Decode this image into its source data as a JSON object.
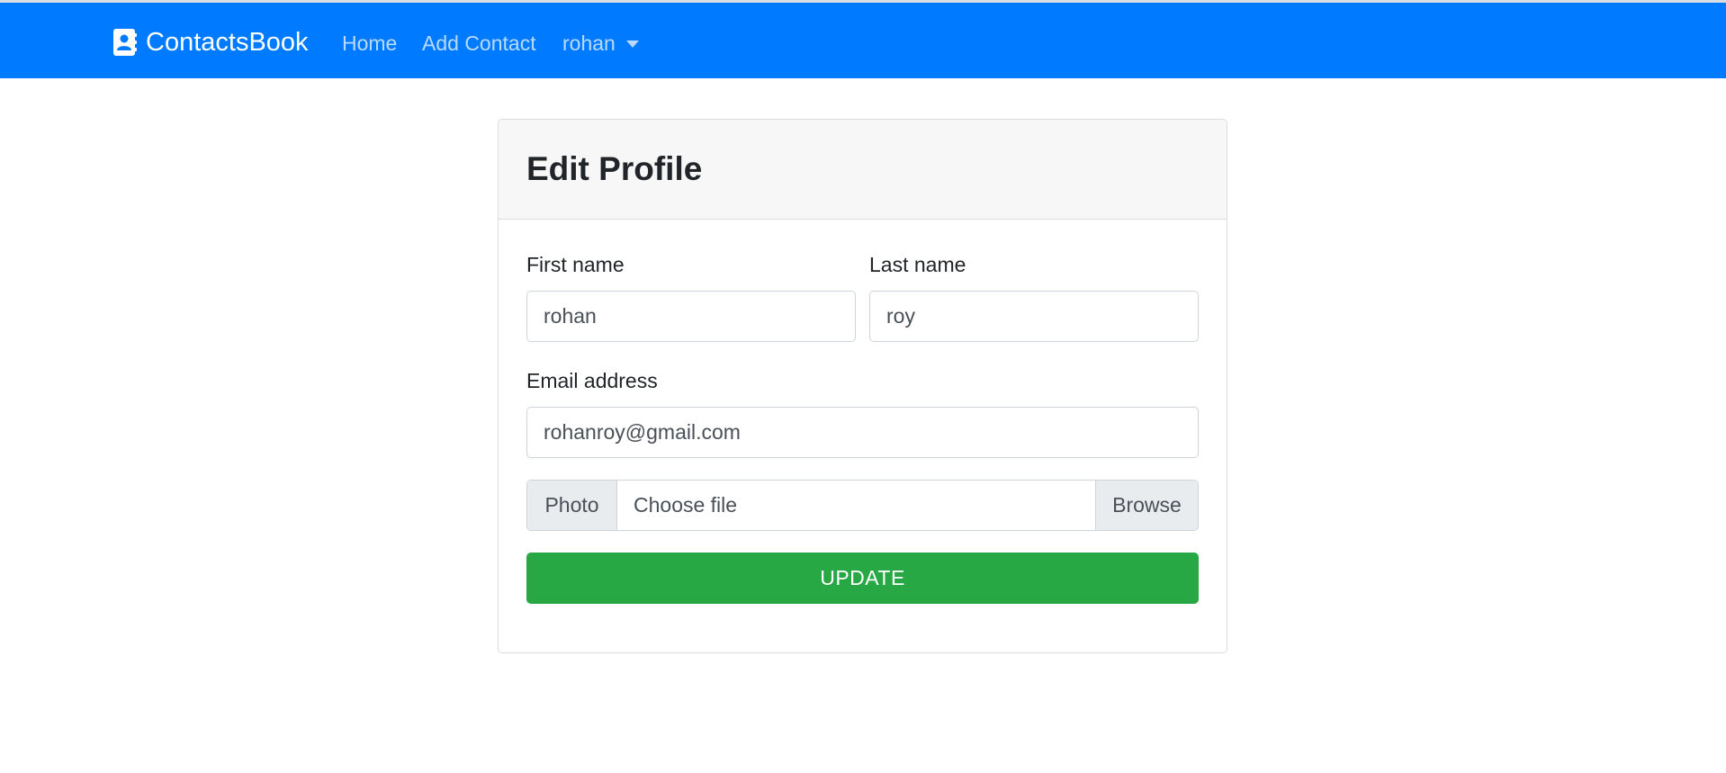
{
  "nav": {
    "brand": "ContactsBook",
    "brand_icon": "contact-book-icon",
    "links": [
      "Home",
      "Add Contact"
    ],
    "user": "rohan",
    "user_menu_icon": "caret-down-icon",
    "colors": {
      "navbar_bg": "#007bff",
      "link": "#b3d7ff"
    }
  },
  "card": {
    "title": "Edit Profile",
    "form": {
      "first_name": {
        "label": "First name",
        "value": "rohan"
      },
      "last_name": {
        "label": "Last name",
        "value": "roy"
      },
      "email": {
        "label": "Email address",
        "value": "rohanroy@gmail.com"
      },
      "photo": {
        "label": "Photo",
        "placeholder": "Choose file",
        "browse": "Browse"
      },
      "submit": "UPDATE"
    },
    "colors": {
      "submit_bg": "#28a745",
      "header_bg": "#f7f7f7"
    }
  }
}
